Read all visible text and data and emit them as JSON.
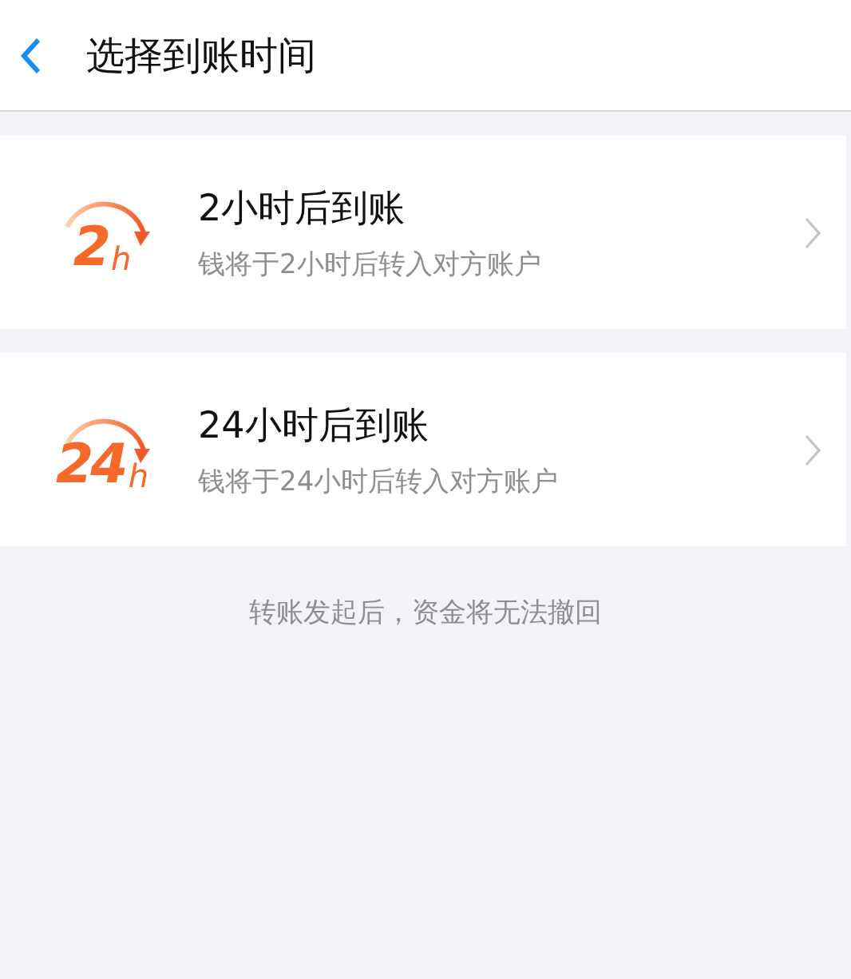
{
  "header": {
    "title": "选择到账时间"
  },
  "options": [
    {
      "badge_number": "2",
      "badge_unit": "h",
      "title": "2小时后到账",
      "subtitle": "钱将于2小时后转入对方账户"
    },
    {
      "badge_number": "24",
      "badge_unit": "h",
      "title": "24小时后到账",
      "subtitle": "钱将于24小时后转入对方账户"
    }
  ],
  "note": "转账发起后，资金将无法撤回"
}
